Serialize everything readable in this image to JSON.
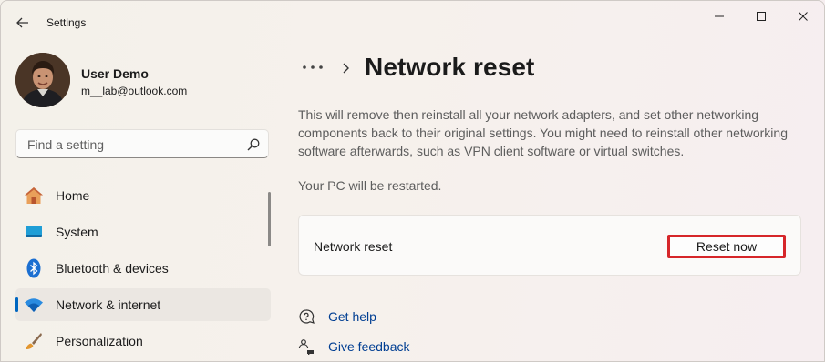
{
  "window": {
    "app_title": "Settings",
    "back_icon": "arrow-left-icon",
    "controls": [
      "minimize-icon",
      "maximize-icon",
      "close-icon"
    ]
  },
  "user": {
    "name": "User Demo",
    "email": "m__lab@outlook.com"
  },
  "search": {
    "placeholder": "Find a setting",
    "value": ""
  },
  "sidebar": {
    "items": [
      {
        "label": "Home",
        "icon": "home-icon",
        "active": false
      },
      {
        "label": "System",
        "icon": "monitor-icon",
        "active": false
      },
      {
        "label": "Bluetooth & devices",
        "icon": "bluetooth-icon",
        "active": false
      },
      {
        "label": "Network & internet",
        "icon": "wifi-icon",
        "active": true
      },
      {
        "label": "Personalization",
        "icon": "brush-icon",
        "active": false
      }
    ]
  },
  "main": {
    "breadcrumb_more": "...",
    "title": "Network reset",
    "description": "This will remove then reinstall all your network adapters, and set other networking components back to their original settings. You might need to reinstall other networking software afterwards, such as VPN client software or virtual switches.",
    "restart_note": "Your PC will be restarted.",
    "card": {
      "label": "Network reset",
      "button_label": "Reset now"
    },
    "links": [
      {
        "label": "Get help",
        "icon": "help-icon"
      },
      {
        "label": "Give feedback",
        "icon": "feedback-icon"
      }
    ]
  },
  "colors": {
    "accent": "#0067c0",
    "highlight_border": "#d6262a",
    "link": "#003e92"
  }
}
